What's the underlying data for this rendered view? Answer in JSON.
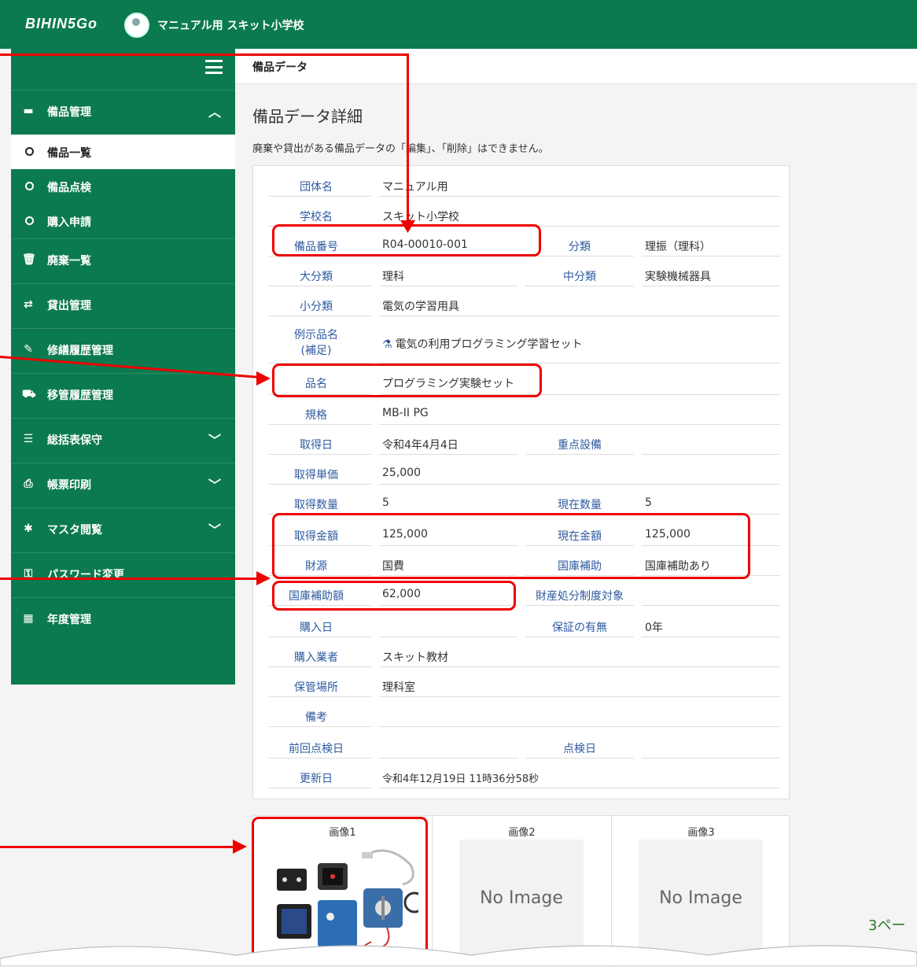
{
  "header": {
    "logo": "BIHIN5Go",
    "school": "マニュアル用 スキット小学校"
  },
  "sidebar": {
    "items": [
      {
        "label": "備品管理",
        "chev": "︿"
      },
      {
        "label": "廃棄一覧"
      },
      {
        "label": "貸出管理"
      },
      {
        "label": "修繕履歴管理"
      },
      {
        "label": "移管履歴管理"
      },
      {
        "label": "総括表保守",
        "chev": "﹀"
      },
      {
        "label": "帳票印刷",
        "chev": "﹀"
      },
      {
        "label": "マスタ閲覧",
        "chev": "﹀"
      },
      {
        "label": "パスワード変更"
      },
      {
        "label": "年度管理"
      }
    ],
    "sub": [
      "備品一覧",
      "備品点検",
      "購入申請"
    ]
  },
  "breadcrumb": "備品データ",
  "page_title": "備品データ詳細",
  "note": "廃棄や貸出がある備品データの「編集」、「削除」はできません。",
  "fields": {
    "group_label": "団体名",
    "group_value": "マニュアル用",
    "school_label": "学校名",
    "school_value": "スキット小学校",
    "number_label": "備品番号",
    "number_value": "R04-00010-001",
    "class_label": "分類",
    "class_value": "理振（理科）",
    "major_label": "大分類",
    "major_value": "理科",
    "mid_label": "中分類",
    "mid_value": "実験機械器具",
    "minor_label": "小分類",
    "minor_value": "電気の学習用具",
    "example_label": "例示品名",
    "example_label2": "(補足)",
    "example_value": "電気の利用プログラミング学習セット",
    "name_label": "品名",
    "name_value": "プログラミング実験セット",
    "spec_label": "規格",
    "spec_value": "MB-II PG",
    "date_label": "取得日",
    "date_value": "令和4年4月4日",
    "key_label": "重点設備",
    "key_value": "",
    "unit_label": "取得単価",
    "unit_value": "25,000",
    "qty_label": "取得数量",
    "qty_value": "5",
    "curqty_label": "現在数量",
    "curqty_value": "5",
    "amount_label": "取得金額",
    "amount_value": "125,000",
    "curamount_label": "現在金額",
    "curamount_value": "125,000",
    "source_label": "財源",
    "source_value": "国費",
    "subsidy_label": "国庫補助",
    "subsidy_value": "国庫補助あり",
    "subsidyamt_label": "国庫補助額",
    "subsidyamt_value": "62,000",
    "disposal_label": "財産処分制度対象",
    "disposal_value": "",
    "purchase_label": "購入日",
    "purchase_value": "",
    "warranty_label": "保証の有無",
    "warranty_value": "0年",
    "vendor_label": "購入業者",
    "vendor_value": "スキット教材",
    "location_label": "保管場所",
    "location_value": "理科室",
    "remarks_label": "備考",
    "remarks_value": "",
    "lastcheck_label": "前回点検日",
    "lastcheck_value": "",
    "check_label": "点検日",
    "check_value": "",
    "updated_label": "更新日",
    "updated_value": "令和4年12月19日 11時36分58秒"
  },
  "images": {
    "cap1": "画像1",
    "cap2": "画像2",
    "cap3": "画像3",
    "no_image": "No Image"
  },
  "page_number": "3ペー",
  "colors": {
    "brand_green": "#0b7a4f",
    "highlight_red": "#e00000",
    "label_blue": "#2d5aa0"
  }
}
